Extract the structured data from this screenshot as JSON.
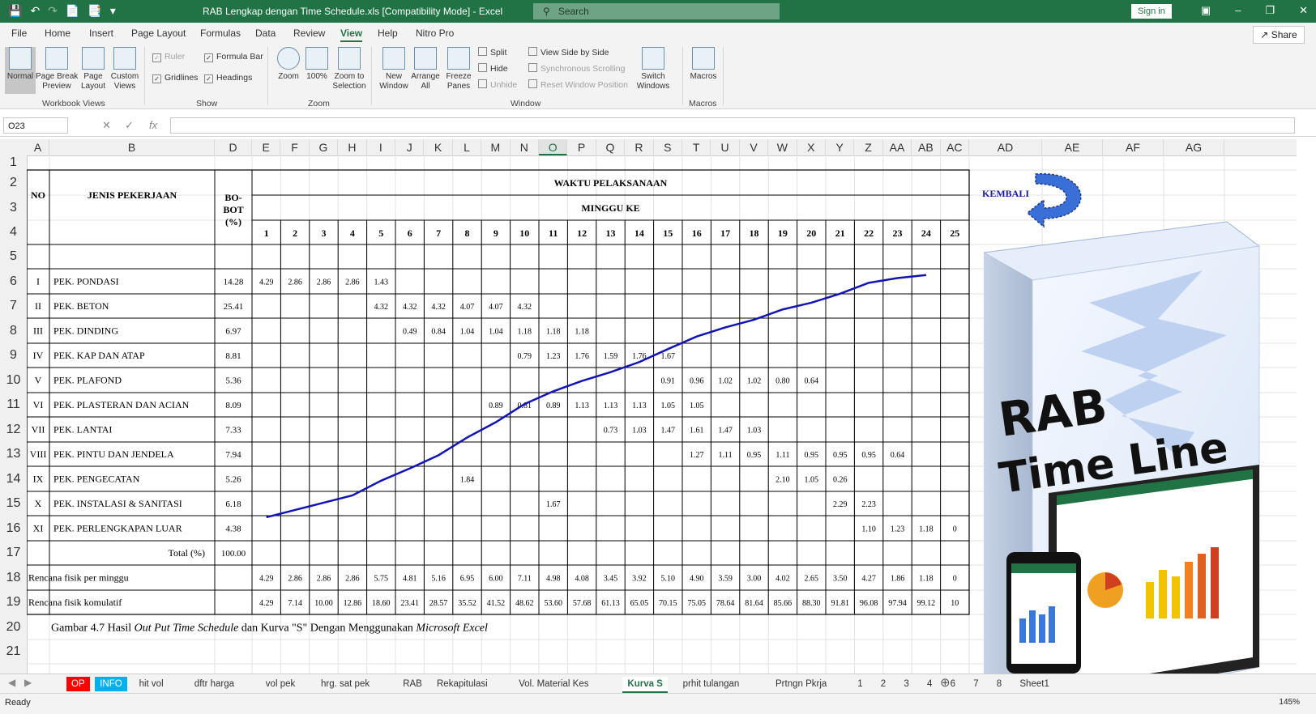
{
  "window": {
    "title": "RAB Lengkap dengan Time Schedule.xls  [Compatibility Mode]  -  Excel",
    "search_placeholder": "Search",
    "signin_label": "Sign in"
  },
  "menu": {
    "tabs": [
      "File",
      "Home",
      "Insert",
      "Page Layout",
      "Formulas",
      "Data",
      "Review",
      "View",
      "Help",
      "Nitro Pro"
    ],
    "active_tab": "View",
    "share_label": "Share"
  },
  "ribbon": {
    "workbook_views": {
      "label": "Workbook Views",
      "buttons": [
        "Normal",
        "Page Break\nPreview",
        "Page\nLayout",
        "Custom\nViews"
      ]
    },
    "show": {
      "label": "Show",
      "ruler": "Ruler",
      "formula_bar": "Formula Bar",
      "gridlines": "Gridlines",
      "headings": "Headings"
    },
    "zoom": {
      "label": "Zoom",
      "buttons": [
        "Zoom",
        "100%",
        "Zoom to\nSelection"
      ]
    },
    "window": {
      "label": "Window",
      "new_window": "New\nWindow",
      "arrange_all": "Arrange\nAll",
      "freeze_panes": "Freeze\nPanes",
      "split": "Split",
      "hide": "Hide",
      "unhide": "Unhide",
      "view_side": "View Side by Side",
      "sync_scroll": "Synchronous Scrolling",
      "reset_pos": "Reset Window Position",
      "switch_windows": "Switch\nWindows"
    },
    "macros": {
      "label": "Macros",
      "button": "Macros"
    }
  },
  "formula_bar": {
    "name_box": "O23",
    "fx": "fx",
    "value": ""
  },
  "columns": [
    "A",
    "B",
    "D",
    "E",
    "F",
    "G",
    "H",
    "I",
    "J",
    "K",
    "L",
    "M",
    "N",
    "O",
    "P",
    "Q",
    "R",
    "S",
    "T",
    "U",
    "V",
    "W",
    "X",
    "Y",
    "Z",
    "AA",
    "AB",
    "AC",
    "AD",
    "AE",
    "AF",
    "AG"
  ],
  "selected_column": "O",
  "rows": [
    "1",
    "2",
    "3",
    "4",
    "5",
    "6",
    "7",
    "8",
    "9",
    "10",
    "11",
    "12",
    "13",
    "14",
    "15",
    "16",
    "17",
    "18",
    "19",
    "20",
    "21"
  ],
  "sheet": {
    "header_no": "NO",
    "header_job": "JENIS PEKERJAAN",
    "header_weight": [
      "BO-",
      "BOT",
      "(%)"
    ],
    "header_time": "WAKTU PELAKSANAAN",
    "header_week": "MINGGU KE",
    "weeks": [
      "1",
      "2",
      "3",
      "4",
      "5",
      "6",
      "7",
      "8",
      "9",
      "10",
      "11",
      "12",
      "13",
      "14",
      "15",
      "16",
      "17",
      "18",
      "19",
      "20",
      "21",
      "22",
      "23",
      "24",
      "25"
    ],
    "kembali_label": "KEMBALI",
    "items": [
      {
        "no": "I",
        "name": "PEK. PONDASI",
        "weight": "14.28",
        "cells": {
          "1": "4.29",
          "2": "2.86",
          "3": "2.86",
          "4": "2.86",
          "5": "1.43"
        }
      },
      {
        "no": "II",
        "name": "PEK. BETON",
        "weight": "25.41",
        "cells": {
          "5": "4.32",
          "6": "4.32",
          "7": "4.32",
          "8": "4.07",
          "9": "4.07",
          "10": "4.32"
        }
      },
      {
        "no": "III",
        "name": "PEK. DINDING",
        "weight": "6.97",
        "cells": {
          "6": "0.49",
          "7": "0.84",
          "8": "1.04",
          "9": "1.04",
          "10": "1.18",
          "11": "1.18",
          "12": "1.18"
        }
      },
      {
        "no": "IV",
        "name": "PEK. KAP DAN ATAP",
        "weight": "8.81",
        "cells": {
          "10": "0.79",
          "11": "1.23",
          "12": "1.76",
          "13": "1.59",
          "14": "1.76",
          "15": "1.67"
        }
      },
      {
        "no": "V",
        "name": "PEK. PLAFOND",
        "weight": "5.36",
        "cells": {
          "15": "0.91",
          "16": "0.96",
          "17": "1.02",
          "18": "1.02",
          "19": "0.80",
          "20": "0.64"
        }
      },
      {
        "no": "VI",
        "name": "PEK. PLASTERAN DAN ACIAN",
        "weight": "8.09",
        "cells": {
          "9": "0.89",
          "10": "0.81",
          "11": "0.89",
          "12": "1.13",
          "13": "1.13",
          "14": "1.13",
          "15": "1.05",
          "16": "1.05"
        }
      },
      {
        "no": "VII",
        "name": "PEK. LANTAI",
        "weight": "7.33",
        "cells": {
          "13": "0.73",
          "14": "1.03",
          "15": "1.47",
          "16": "1.61",
          "17": "1.47",
          "18": "1.03"
        }
      },
      {
        "no": "VIII",
        "name": "PEK. PINTU DAN JENDELA",
        "weight": "7.94",
        "cells": {
          "16": "1.27",
          "17": "1.11",
          "18": "0.95",
          "19": "1.11",
          "20": "0.95",
          "21": "0.95",
          "22": "0.95",
          "23": "0.64"
        }
      },
      {
        "no": "IX",
        "name": "PEK. PENGECATAN",
        "weight": "5.26",
        "cells": {
          "8": "1.84",
          "19": "2.10",
          "20": "1.05",
          "21": "0.26"
        }
      },
      {
        "no": "X",
        "name": "PEK. INSTALASI & SANITASI",
        "weight": "6.18",
        "cells": {
          "11": "1.67",
          "21": "2.29",
          "22": "2.23"
        }
      },
      {
        "no": "XI",
        "name": "PEK. PERLENGKAPAN LUAR",
        "weight": "4.38",
        "cells": {
          "22": "1.10",
          "23": "1.23",
          "24": "1.18",
          "25": "0"
        }
      }
    ],
    "total_label": "Total  (%)",
    "total_value": "100.00",
    "plan_weekly_label": "Rencana fisik per minggu",
    "plan_weekly": [
      "4.29",
      "2.86",
      "2.86",
      "2.86",
      "5.75",
      "4.81",
      "5.16",
      "6.95",
      "6.00",
      "7.11",
      "4.98",
      "4.08",
      "3.45",
      "3.92",
      "5.10",
      "4.90",
      "3.59",
      "3.00",
      "4.02",
      "2.65",
      "3.50",
      "4.27",
      "1.86",
      "1.18",
      "0"
    ],
    "plan_cum_label": "Rencana fisik komulatif",
    "plan_cum": [
      "4.29",
      "7.14",
      "10.00",
      "12.86",
      "18.60",
      "23.41",
      "28.57",
      "35.52",
      "41.52",
      "48.62",
      "53.60",
      "57.68",
      "61.13",
      "65.05",
      "70.15",
      "75.05",
      "78.64",
      "81.64",
      "85.66",
      "88.30",
      "91.81",
      "96.08",
      "97.94",
      "99.12",
      "10"
    ],
    "caption_parts": [
      "Gambar 4.7 Hasil ",
      "Out Put Time Schedule",
      " dan Kurva \"S\" Dengan Menggunakan ",
      "Microsoft Excel"
    ]
  },
  "sheet_tabs": [
    "OP",
    "INFO",
    "hit vol",
    "dftr harga",
    "vol pek",
    "hrg. sat pek",
    "RAB",
    "Rekapitulasi",
    "Vol. Material Kes",
    "Kurva S",
    "prhit tulangan",
    "Prtngn Pkrja",
    "1",
    "2",
    "3",
    "4",
    "6",
    "7",
    "8",
    "Sheet1"
  ],
  "active_sheet": "Kurva S",
  "status": {
    "ready": "Ready",
    "zoom": "145%"
  },
  "promo": {
    "line1": "RAB",
    "line2": "Time Line"
  },
  "colors": {
    "excel_green": "#217346",
    "curve": "#1414b4",
    "tab_red": "#ff0000",
    "tab_blue": "#00b0f0"
  }
}
